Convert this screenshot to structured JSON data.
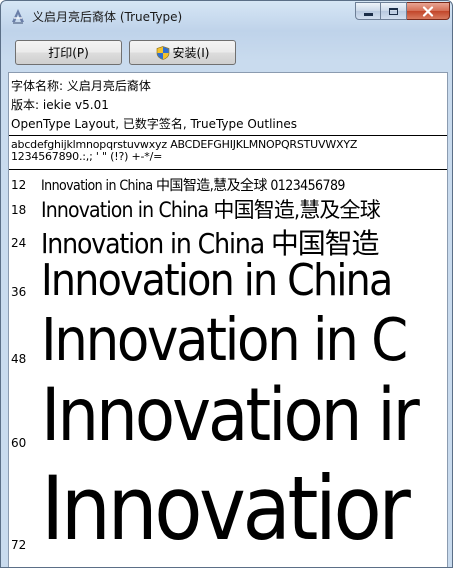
{
  "window": {
    "title": "义启月亮后裔体 (TrueType)"
  },
  "toolbar": {
    "print_label": "打印(P)",
    "install_label": "安装(I)"
  },
  "font_info": {
    "name_line": "字体名称: 义启月亮后裔体",
    "version_line": "版本: iekie v5.01",
    "features_line": "OpenType Layout, 已数字签名, TrueType Outlines"
  },
  "charset": {
    "line1": "abcdefghijklmnopqrstuvwxyz ABCDEFGHIJKLMNOPQRSTUVWXYZ",
    "line2": "1234567890.:,; ' \" (!?) +-*/="
  },
  "samples": [
    {
      "size": "12",
      "text": "Innovation in China 中国智造,慧及全球 0123456789"
    },
    {
      "size": "18",
      "text": "Innovation in China 中国智造,慧及全球"
    },
    {
      "size": "24",
      "text": "Innovation in China 中国智造"
    },
    {
      "size": "36",
      "text": "Innovation in China"
    },
    {
      "size": "48",
      "text": "Innovation in C"
    },
    {
      "size": "60",
      "text": "Innovation ir"
    },
    {
      "size": "72",
      "text": "Innovatior"
    }
  ]
}
